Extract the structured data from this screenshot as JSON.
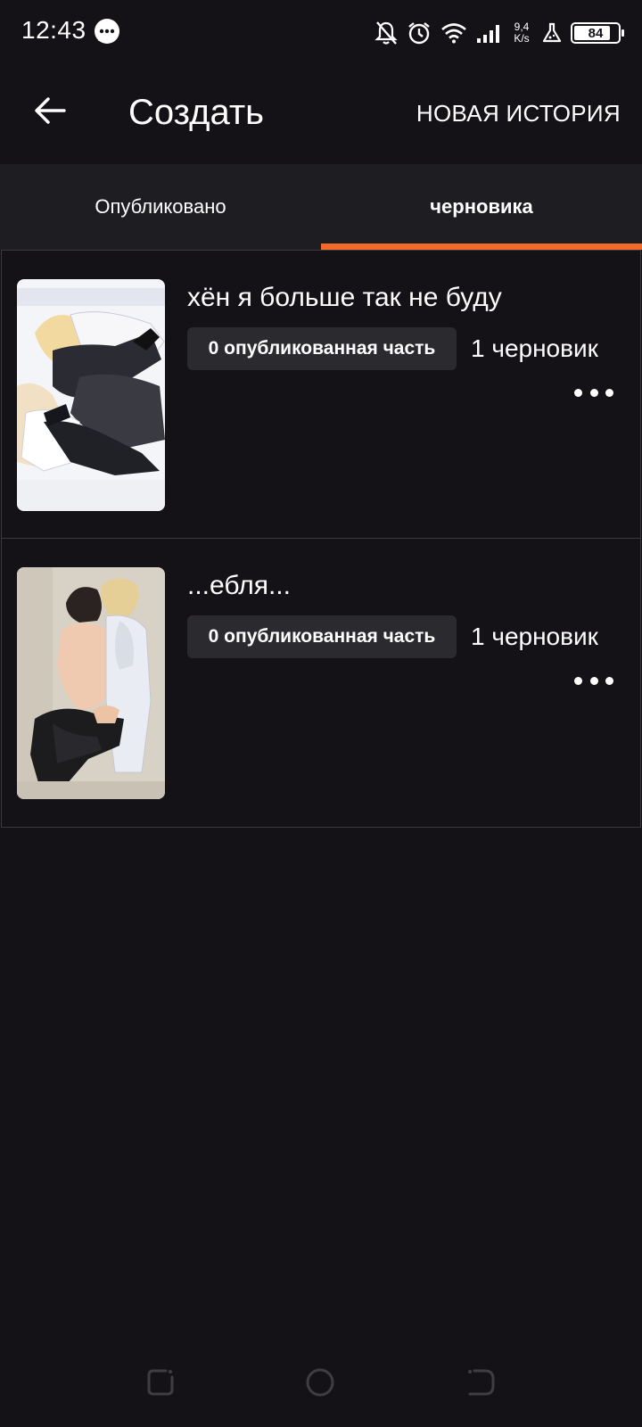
{
  "status_bar": {
    "time": "12:43",
    "net_speed_value": "9,4",
    "net_speed_unit": "K/s",
    "battery": "84",
    "battery_level": 0.84,
    "icons": [
      "chat-bubble-icon",
      "bell-off-icon",
      "alarm-icon",
      "wifi-icon",
      "signal-icon",
      "flask-icon",
      "battery-icon"
    ]
  },
  "header": {
    "title": "Создать",
    "new_story_label": "НОВАЯ ИСТОРИЯ"
  },
  "tabs": [
    {
      "label": "Опубликовано",
      "active": false
    },
    {
      "label": "черновика",
      "active": true
    }
  ],
  "stories": [
    {
      "title": "хён я больше так не буду",
      "published_parts": "0 опубликованная часть",
      "drafts": "1 черновик"
    },
    {
      "title": "...ебля...",
      "published_parts": "0 опубликованная часть",
      "drafts": "1 черновик"
    }
  ],
  "colors": {
    "background": "#141216",
    "tab_bar": "#1e1d21",
    "accent": "#f26b2a",
    "badge": "#2b2a2f"
  }
}
